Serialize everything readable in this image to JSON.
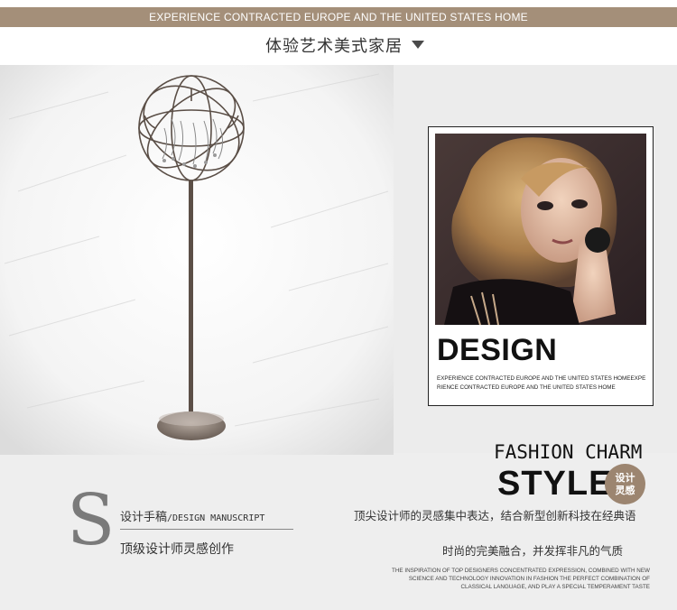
{
  "header": {
    "banner_text": "EXPERIENCE CONTRACTED EUROPE AND THE UNITED STATES HOME",
    "subtitle": "体验艺术美式家居",
    "dropdown_icon": "triangle-down-icon"
  },
  "feature_card": {
    "heading": "DESIGN",
    "small_text": "EXPERIENCE CONTRACTED EUROPE AND THE UNITED STATES HOMEEXPERIENCE CONTRACTED EUROPE AND THE UNITED STATES HOME"
  },
  "style_block": {
    "fashion": "FASHION CHARM",
    "style": "STYLE",
    "badge_line1": "设计",
    "badge_line2": "灵感"
  },
  "manuscript": {
    "letter": "S",
    "line1_cn": "设计手稿",
    "line1_en": "/DESIGN MANUSCRIPT",
    "line2": "顶级设计师灵感创作"
  },
  "description": {
    "line1": "顶尖设计师的灵感集中表达，结合新型创新科技在经典语",
    "line2": "时尚的完美融合，并发挥非凡的气质",
    "small": "THE INSPIRATION OF TOP DESIGNERS CONCENTRATED EXPRESSION, COMBINED WITH NEW SCIENCE AND TECHNOLOGY INNOVATION IN FASHION THE PERFECT COMBINATION OF CLASSICAL LANGUAGE, AND PLAY A SPECIAL TEMPERAMENT TASTE"
  },
  "colors": {
    "accent": "#a48f79",
    "badge": "#9c8570"
  }
}
